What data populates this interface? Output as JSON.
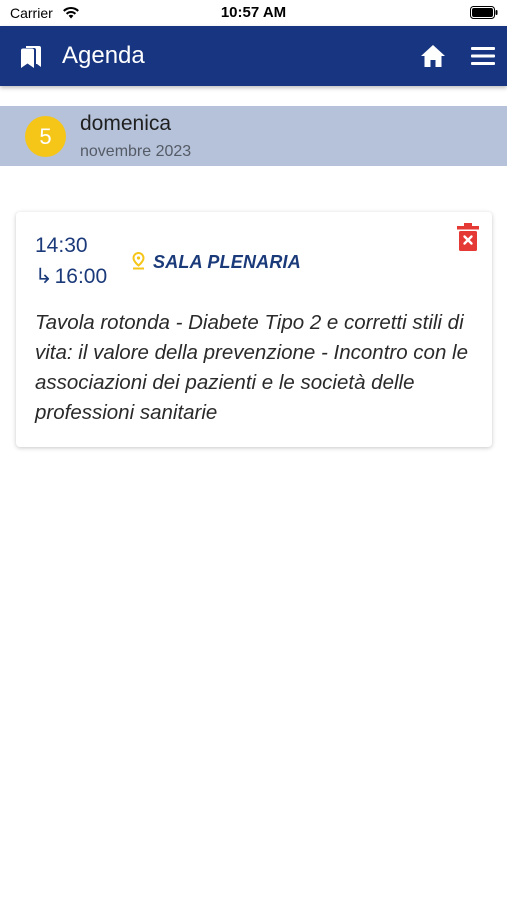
{
  "status_bar": {
    "carrier": "Carrier",
    "time": "10:57 AM",
    "icons": [
      "wifi-icon",
      "battery-icon"
    ]
  },
  "app_bar": {
    "title": "Agenda",
    "background_color": "#173580",
    "icons": [
      "bookmarks-icon",
      "home-icon",
      "menu-icon"
    ]
  },
  "day_header": {
    "day_number": "5",
    "day_name": "domenica",
    "month_year": "novembre 2023",
    "badge_color": "#f5c518",
    "background_color": "#b5c2d9"
  },
  "event": {
    "start_time": "14:30",
    "end_arrow": "↳",
    "end_time": "16:00",
    "location": "SALA PLENARIA",
    "location_icon": "location-pin-icon",
    "delete_icon": "delete-icon",
    "delete_color": "#e53935",
    "title": "Tavola rotonda - Diabete Tipo 2 e corretti stili di vita: il valore della prevenzione - Incontro con le associazioni dei pazienti e le società delle professioni sanitarie"
  }
}
